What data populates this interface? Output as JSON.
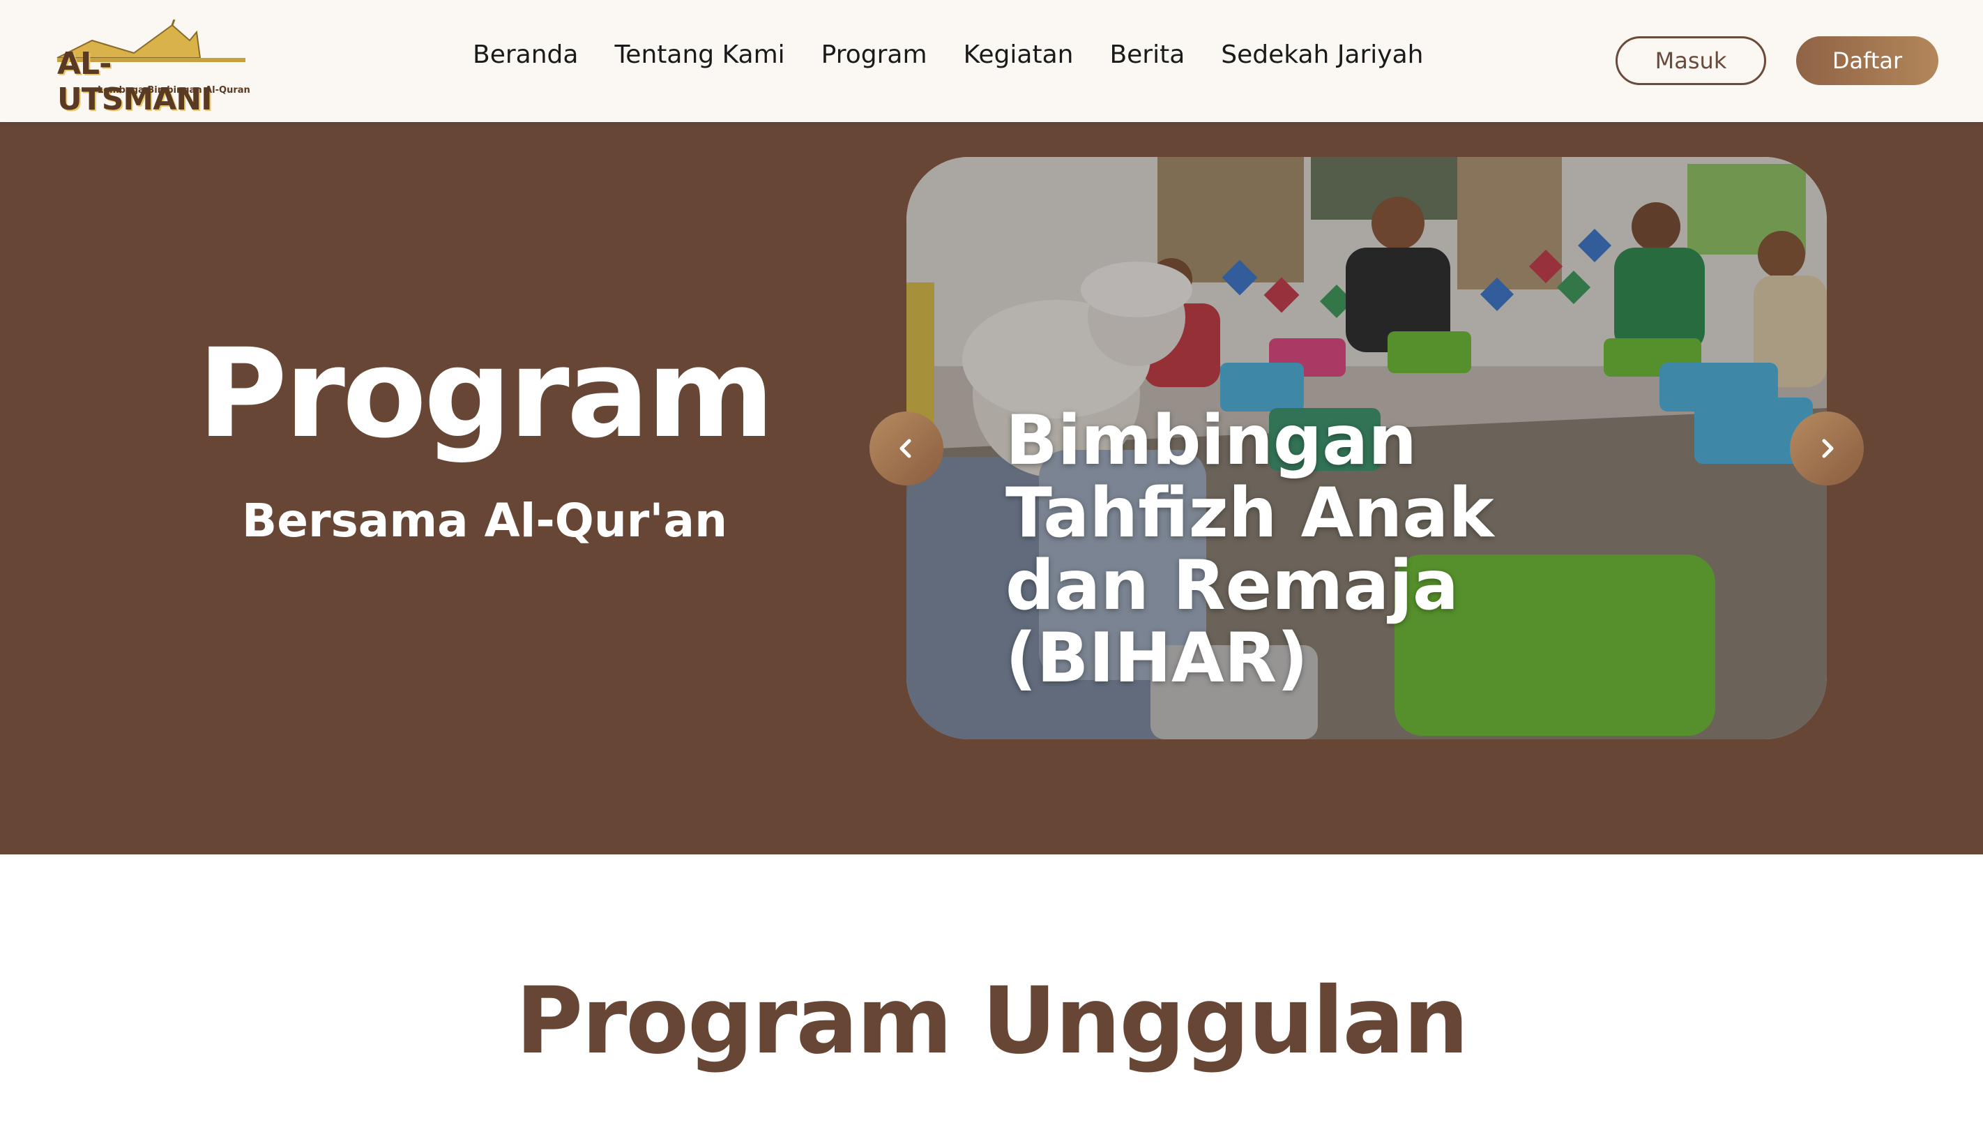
{
  "brand": {
    "name": "AL-UTSMANI",
    "tagline": "Lembaga Bimbingan Al-Quran",
    "primary_color": "#674635",
    "accent_color": "#b3875a"
  },
  "nav": {
    "items": [
      {
        "label": "Beranda"
      },
      {
        "label": "Tentang Kami"
      },
      {
        "label": "Program"
      },
      {
        "label": "Kegiatan"
      },
      {
        "label": "Berita"
      },
      {
        "label": "Sedekah Jariyah"
      }
    ]
  },
  "auth": {
    "login_label": "Masuk",
    "register_label": "Daftar"
  },
  "hero": {
    "title": "Program",
    "subtitle": "Bersama Al-Qur'an",
    "slide": {
      "caption": "Bimbingan Tahfizh Anak dan Remaja (BIHAR)"
    },
    "prev_icon": "chevron-left-icon",
    "next_icon": "chevron-right-icon"
  },
  "section": {
    "title": "Program Unggulan"
  }
}
